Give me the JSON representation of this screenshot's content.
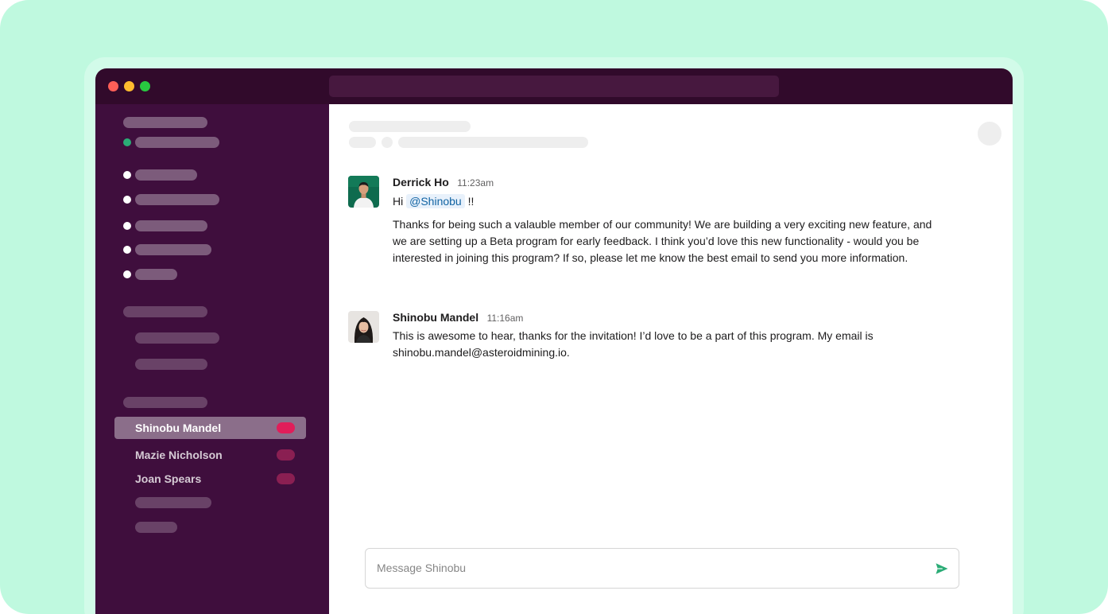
{
  "channel": {
    "messages": [
      {
        "author": "Derrick Ho",
        "time": "11:23am",
        "greeting": "Hi",
        "mention": "@Shinobu",
        "greeting_suffix": "!!",
        "text": "Thanks for being such a valauble member of our community! We are building a very exciting new feature, and we are setting up a Beta program for early feedback. I think you’d love this new functionality - would you be interested in joining this program? If so, please let me know the best email to send you more information."
      },
      {
        "author": "Shinobu Mandel",
        "time": "11:16am",
        "text": "This is awesome to hear, thanks for the invitation! I’d love to be a part of this program. My email is shinobu.mandel@asteroidmining.io."
      }
    ]
  },
  "sidebar": {
    "direct_messages": [
      {
        "name": "Shinobu Mandel",
        "active": true
      },
      {
        "name": "Mazie Nicholson",
        "active": false
      },
      {
        "name": "Joan Spears",
        "active": false
      }
    ]
  },
  "composer": {
    "placeholder": "Message Shinobu"
  },
  "icons": {
    "send": "send-icon",
    "window_close": "close-dot",
    "window_minimize": "minimize-dot",
    "window_maximize": "maximize-dot"
  },
  "colors": {
    "sidebar_bg": "#3f0e3d",
    "titlebar_bg": "#310a2b",
    "badge": "#e01e5a",
    "send": "#2bac76",
    "mention_text": "#1264a3",
    "page_bg": "#bff9df"
  }
}
